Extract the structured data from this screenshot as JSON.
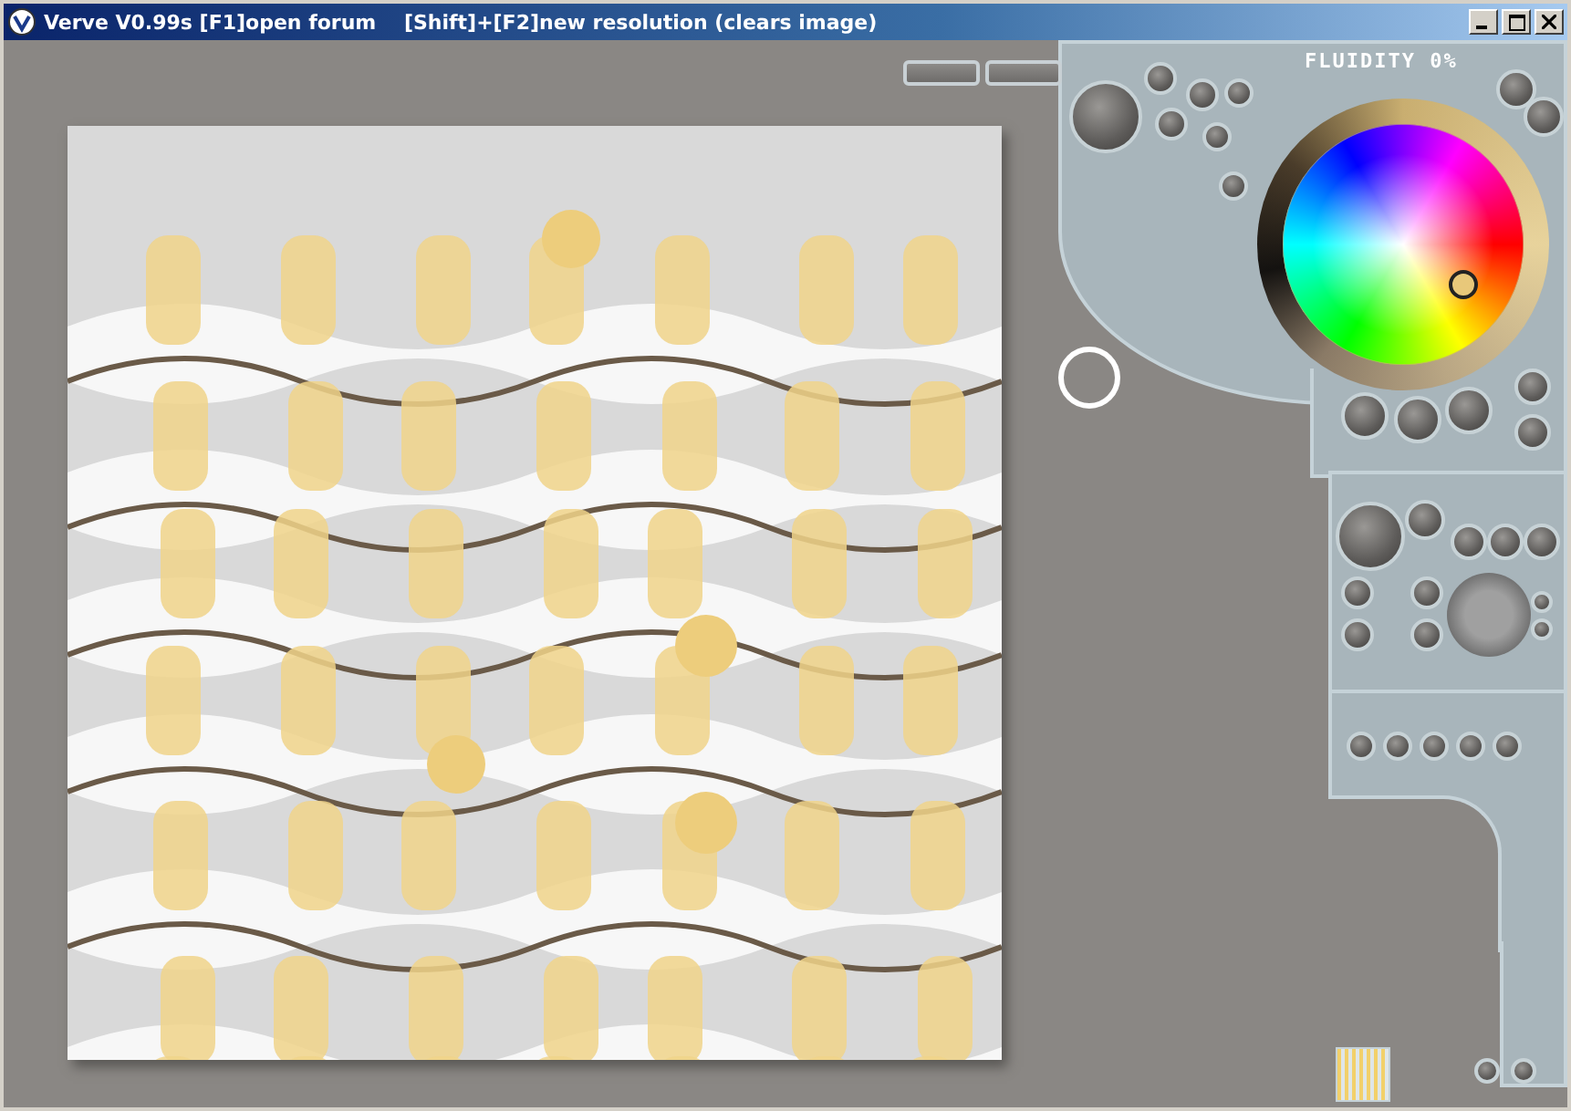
{
  "window": {
    "title": "Verve V0.99s [F1]open forum    [Shift]+[F2]new resolution (clears image)"
  },
  "fluidity": {
    "label": "FLUIDITY 0%"
  }
}
